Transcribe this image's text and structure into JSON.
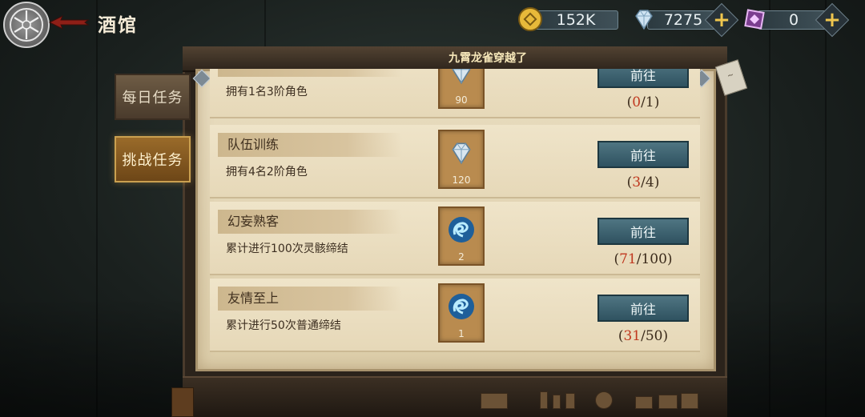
{
  "header": {
    "title": "酒馆"
  },
  "resources": [
    {
      "name": "gold",
      "icon": "coin-icon",
      "value": "152K"
    },
    {
      "name": "gem",
      "icon": "diamond-icon",
      "value": "7275"
    },
    {
      "name": "crystal",
      "icon": "purple-crystal-icon",
      "value": "0"
    }
  ],
  "ticker": {
    "text": "九霄龙雀穿越了"
  },
  "tabs": [
    {
      "label": "每日任务",
      "active": false
    },
    {
      "label": "挑战任务",
      "active": true
    }
  ],
  "tasks": [
    {
      "name": "",
      "desc": "拥有1名3阶角色",
      "reward_icon": "diamond-icon",
      "reward_count": "90",
      "button": "前往",
      "progress_current": "0",
      "progress_total": "1"
    },
    {
      "name": "队伍训练",
      "desc": "拥有4名2阶角色",
      "reward_icon": "diamond-icon",
      "reward_count": "120",
      "button": "前往",
      "progress_current": "3",
      "progress_total": "4"
    },
    {
      "name": "幻妄熟客",
      "desc": "累计进行100次灵骸缔结",
      "reward_icon": "blue-spirit-icon",
      "reward_count": "2",
      "button": "前往",
      "progress_current": "71",
      "progress_total": "100"
    },
    {
      "name": "友情至上",
      "desc": "累计进行50次普通缔结",
      "reward_icon": "blue-spirit-icon",
      "reward_count": "1",
      "button": "前往",
      "progress_current": "31",
      "progress_total": "50"
    }
  ],
  "colors": {
    "progress_current": "#c0381f",
    "go_button": "#3f6472",
    "active_tab": "#9a6b2a",
    "paper": "#e6d8b8"
  }
}
